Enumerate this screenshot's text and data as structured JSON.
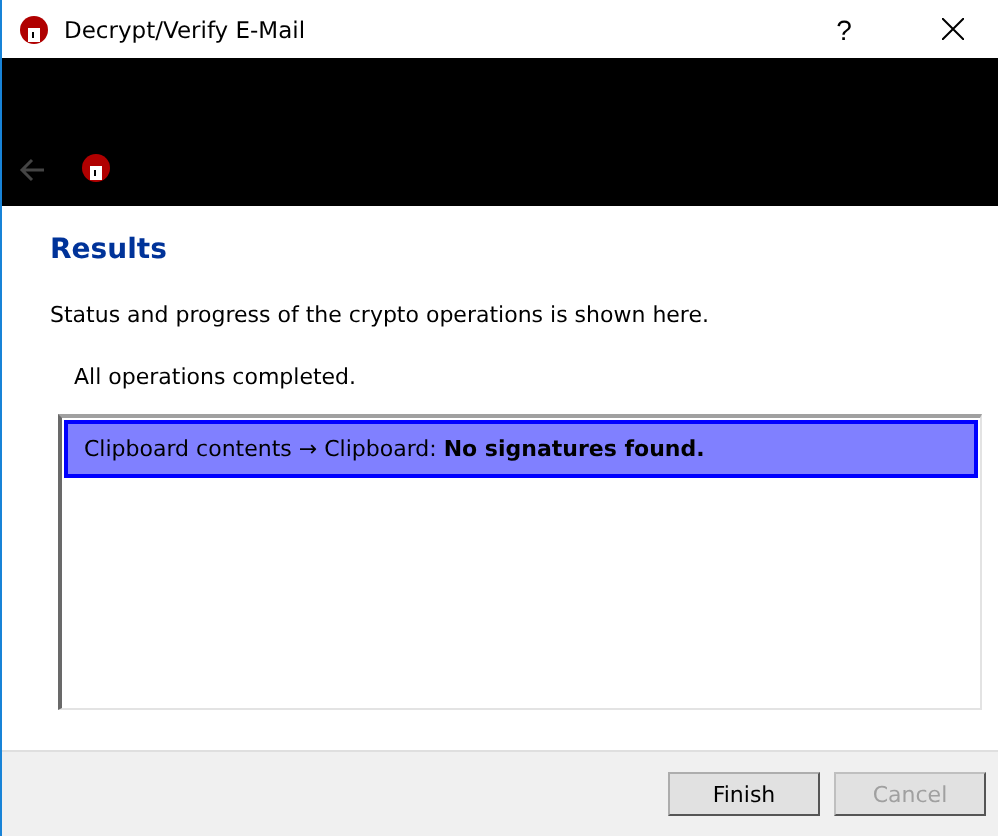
{
  "window": {
    "title": "Decrypt/Verify E-Mail",
    "help": "?"
  },
  "header": {
    "back_disabled": true
  },
  "page": {
    "title": "Results",
    "description": "Status and progress of the crypto operations is shown here.",
    "status": "All operations completed."
  },
  "results": [
    {
      "text": "Clipboard contents → Clipboard: **No signatures found.**",
      "selected": true
    }
  ],
  "buttons": [
    {
      "label": "Finish",
      "disabled": false
    },
    {
      "label": "Cancel",
      "disabled": true
    }
  ]
}
